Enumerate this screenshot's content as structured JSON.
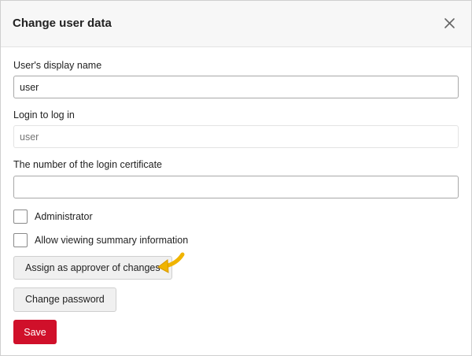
{
  "dialog": {
    "title": "Change user data",
    "close_icon": "close-icon"
  },
  "form": {
    "display_name": {
      "label": "User's display name",
      "value": "user"
    },
    "login": {
      "label": "Login to log in",
      "placeholder": "user",
      "disabled": true
    },
    "certificate": {
      "label": "The number of the login certificate",
      "value": ""
    },
    "administrator": {
      "label": "Administrator",
      "checked": false
    },
    "allow_summary": {
      "label": "Allow viewing summary information",
      "checked": false
    }
  },
  "buttons": {
    "assign_approver": "Assign as approver of changes",
    "change_password": "Change password",
    "save": "Save"
  },
  "annotation": {
    "icon": "pointer-arrow-icon",
    "color": "#f0b400"
  },
  "colors": {
    "primary": "#d0102a",
    "header_bg": "#f7f7f7"
  }
}
